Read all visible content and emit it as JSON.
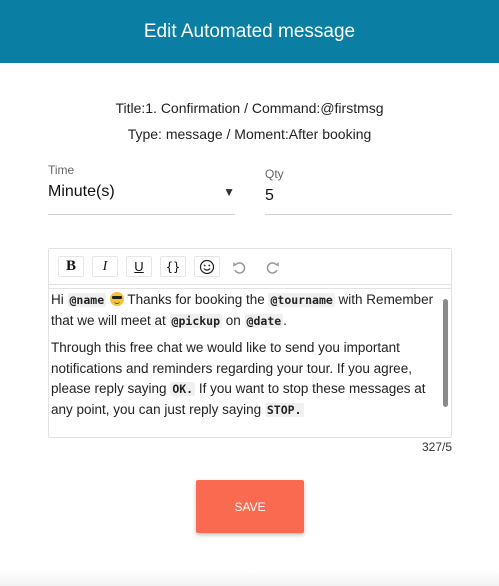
{
  "header": {
    "title": "Edit Automated message"
  },
  "info": {
    "line1": "Title:1. Confirmation / Command:@firstmsg",
    "line2": "Type: message / Moment:After booking"
  },
  "time_field": {
    "label": "Time",
    "value": "Minute(s)"
  },
  "qty_field": {
    "label": "Qty",
    "value": "5"
  },
  "toolbar": {
    "bold": "B",
    "italic": "I",
    "underline": "U",
    "code": "{}"
  },
  "message": {
    "p1": {
      "t1": "Hi ",
      "tag1": "@name",
      "t2": " Thanks for booking the ",
      "tag2": "@tourname",
      "t3": " with Remember that we will  meet at ",
      "tag3": "@pickup",
      "t4": " on ",
      "tag4": "@date",
      "t5": "."
    },
    "p2": {
      "t1": "Through this free chat we would like to send you important notifications and reminders regarding your tour. If you agree, please reply saying ",
      "tag1": "OK.",
      "t2": " If you want to stop these messages at any point, you can just reply saying ",
      "tag2": "STOP."
    }
  },
  "counter": "327/5",
  "save_label": "SAVE",
  "colors": {
    "header": "#0a7ea3",
    "save": "#fa6a50"
  }
}
